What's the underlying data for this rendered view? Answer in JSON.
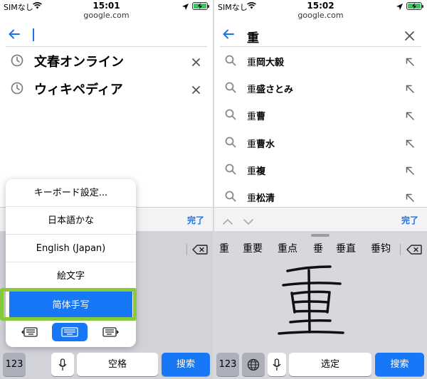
{
  "left": {
    "status": {
      "carrier": "SIMなし",
      "time": "15:01"
    },
    "domain": "google.com",
    "history": [
      {
        "label": "文春オンライン",
        "icon": "history-clock-icon"
      },
      {
        "label": "ウィキペディア",
        "icon": "history-clock-icon"
      }
    ],
    "accessory": {
      "done_label": "完了"
    },
    "keyboard_menu": {
      "items": [
        "キーボード設定...",
        "日本語かな",
        "English (Japan)",
        "絵文字",
        "简体手写"
      ],
      "selected": "简体手写"
    },
    "keys": {
      "numbers": "123",
      "space": "空格",
      "search": "搜索"
    }
  },
  "right": {
    "status": {
      "carrier": "SIMなし",
      "time": "15:02"
    },
    "domain": "google.com",
    "query": "重",
    "suggestions": [
      {
        "typed": "重",
        "rest": "岡大毅"
      },
      {
        "typed": "重",
        "rest": "盛さとみ"
      },
      {
        "typed": "重",
        "rest": "曹"
      },
      {
        "typed": "重",
        "rest": "曹水"
      },
      {
        "typed": "重",
        "rest": "複"
      },
      {
        "typed": "重",
        "rest": "松清"
      }
    ],
    "accessory": {
      "done_label": "完了"
    },
    "candidates": [
      "重",
      "重要",
      "重点",
      "垂",
      "垂直",
      "垂钧"
    ],
    "keys": {
      "numbers": "123",
      "select": "选定",
      "search": "搜索"
    }
  },
  "colors": {
    "accent": "#1677f7",
    "highlight": "#86c93a",
    "battery": "#34c759"
  }
}
